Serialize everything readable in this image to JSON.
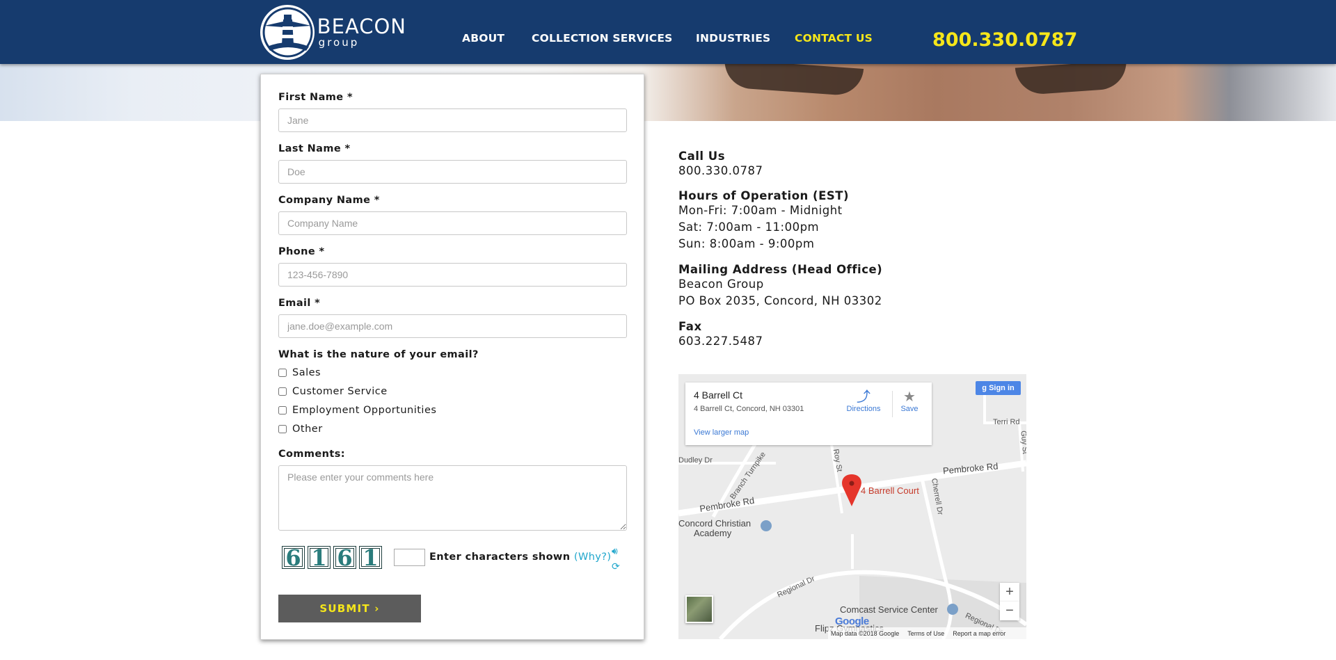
{
  "header": {
    "logo_main": "BEACON",
    "logo_sub": "group",
    "nav": [
      {
        "label": "ABOUT",
        "active": false
      },
      {
        "label": "COLLECTION SERVICES",
        "active": false
      },
      {
        "label": "INDUSTRIES",
        "active": false
      },
      {
        "label": "CONTACT US",
        "active": true
      }
    ],
    "phone": "800.330.0787"
  },
  "form": {
    "first_name": {
      "label": "First Name *",
      "placeholder": "Jane"
    },
    "last_name": {
      "label": "Last Name *",
      "placeholder": "Doe"
    },
    "company": {
      "label": "Company Name *",
      "placeholder": "Company Name"
    },
    "phone": {
      "label": "Phone *",
      "placeholder": "123-456-7890"
    },
    "email": {
      "label": "Email *",
      "placeholder": "jane.doe@example.com"
    },
    "nature_label": "What is the nature of your email?",
    "options": [
      "Sales",
      "Customer Service",
      "Employment Opportunities",
      "Other"
    ],
    "comments": {
      "label": "Comments:",
      "placeholder": "Please enter your comments here"
    },
    "captcha": {
      "digits": [
        "6",
        "1",
        "6",
        "1"
      ],
      "label": "Enter characters shown",
      "why": "(Why?)"
    },
    "submit_label": "SUBMIT"
  },
  "contact": {
    "call_heading": "Call Us",
    "call_value": "800.330.0787",
    "hours_heading": "Hours of Operation (EST)",
    "hours": [
      "Mon-Fri: 7:00am - Midnight",
      "Sat: 7:00am - 11:00pm",
      "Sun: 8:00am - 9:00pm"
    ],
    "mail_heading": "Mailing Address (Head Office)",
    "mail_lines": [
      "Beacon Group",
      "PO Box 2035, Concord, NH 03302"
    ],
    "fax_heading": "Fax",
    "fax_value": "603.227.5487"
  },
  "map": {
    "place_title": "4 Barrell Ct",
    "place_address": "4 Barrell Ct, Concord, NH 03301",
    "view_larger": "View larger map",
    "directions": "Directions",
    "save": "Save",
    "sign_in": "Sign in",
    "pin_label": "4 Barrell Court",
    "labels": {
      "pembroke_rd_right": "Pembroke Rd",
      "pembroke_rd_left": "Pembroke Rd",
      "dudley_dr": "Dudley Dr",
      "roy_st": "Roy St",
      "branch_turnpike": "Branch Turnpike",
      "cherrell_dr": "Cherrell Dr",
      "terri_rd": "Terri Rd",
      "guy_st": "Guy St",
      "regional_dr_left": "Regional Dr",
      "regional_dr_right": "Regional Dr",
      "school_1": "Concord Christian",
      "school_2": "Academy",
      "comcast": "Comcast Service Center",
      "flipz": "Flipz Gymnastics"
    },
    "google": "Google",
    "footer": [
      "Map data ©2018 Google",
      "Terms of Use",
      "Report a map error"
    ]
  }
}
